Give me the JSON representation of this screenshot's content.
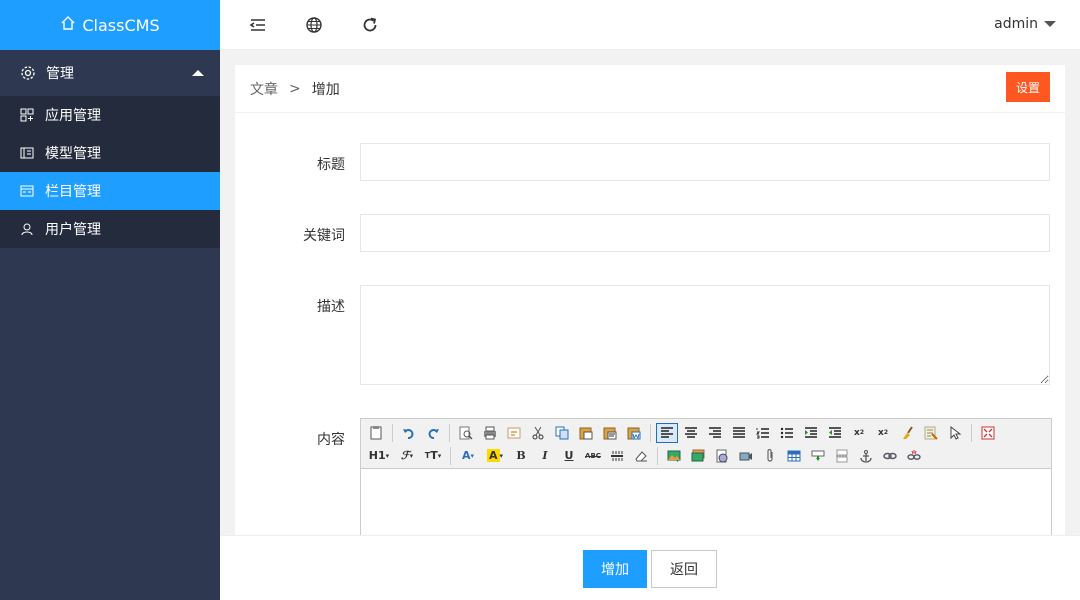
{
  "app": {
    "title": "ClassCMS"
  },
  "sidebar": {
    "section": {
      "label": "管理",
      "icon": "gear-icon",
      "expanded": true
    },
    "items": [
      {
        "label": "应用管理",
        "icon": "apps-icon",
        "active": false
      },
      {
        "label": "模型管理",
        "icon": "model-icon",
        "active": false
      },
      {
        "label": "栏目管理",
        "icon": "channel-icon",
        "active": true
      },
      {
        "label": "用户管理",
        "icon": "user-icon",
        "active": false
      }
    ]
  },
  "topbar": {
    "icons": [
      "menu-collapse-icon",
      "globe-icon",
      "refresh-icon"
    ],
    "user": "admin"
  },
  "breadcrumb": {
    "parent": "文章",
    "separator": ">",
    "current": "增加"
  },
  "header_button": "设置",
  "form": {
    "title_label": "标题",
    "title_value": "",
    "keywords_label": "关键词",
    "keywords_value": "",
    "description_label": "描述",
    "description_value": "",
    "content_label": "内容"
  },
  "editor": {
    "row2_text_buttons": [
      "H1",
      "A",
      "A",
      "B",
      "I",
      "U",
      "ABC"
    ]
  },
  "actions": {
    "submit": "增加",
    "back": "返回"
  },
  "colors": {
    "primary": "#1e9fff",
    "danger": "#ff5722",
    "sidebar": "#2e3951",
    "sidebar_sub": "#232b3d"
  }
}
